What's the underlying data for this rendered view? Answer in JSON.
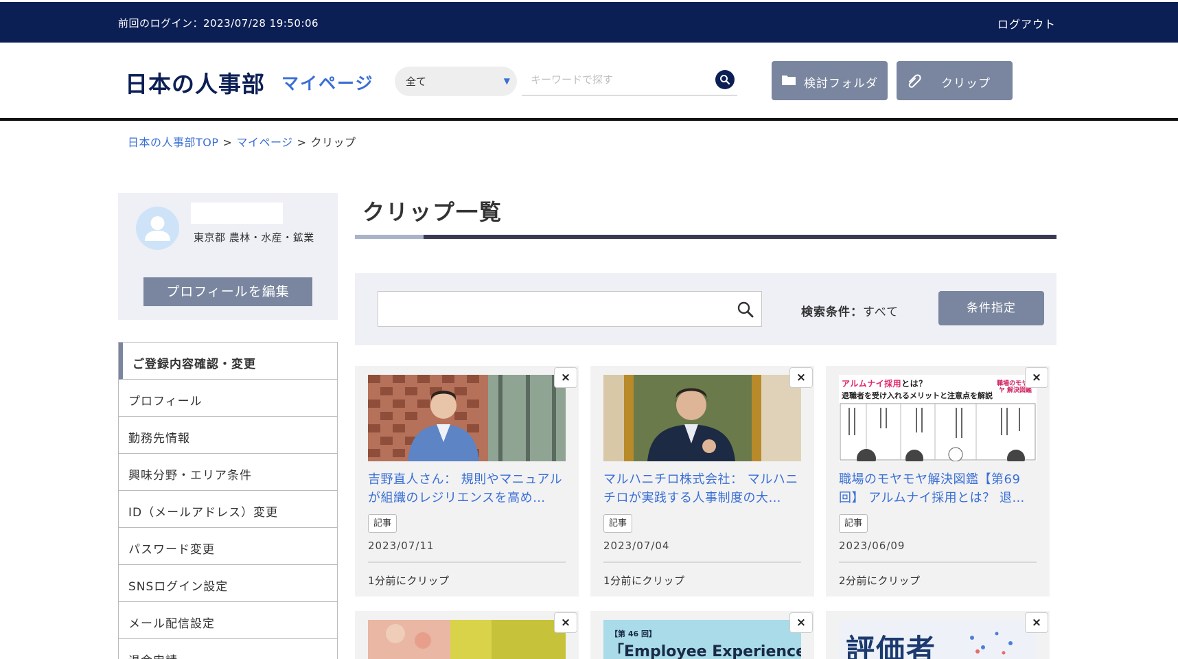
{
  "topbar": {
    "last_login": "前回のログイン：2023/07/28 19:50:06",
    "logout": "ログアウト"
  },
  "header": {
    "logo": "日本の人事部",
    "logo_sub": "マイページ",
    "scope_select": "全て",
    "keyword_placeholder": "キーワードで探す",
    "folder_button": "検討フォルダ",
    "clip_button": "クリップ"
  },
  "breadcrumb": {
    "items": [
      "日本の人事部TOP",
      "マイページ"
    ],
    "separator": ">",
    "current": "クリップ"
  },
  "profile": {
    "location": "東京都 農林・水産・鉱業",
    "edit_button": "プロフィールを編集"
  },
  "side_menu": {
    "header": "ご登録内容確認・変更",
    "items": [
      "プロフィール",
      "勤務先情報",
      "興味分野・エリア条件",
      "ID（メールアドレス）変更",
      "パスワード変更",
      "SNSログイン設定",
      "メール配信設定",
      "退会申請"
    ]
  },
  "main": {
    "title": "クリップ一覧",
    "filter": {
      "placeholder": "",
      "condition_label": "検索条件：",
      "condition_value": "すべて",
      "condition_button": "条件指定"
    },
    "cards": [
      {
        "title": "吉野直人さん： 規則やマニュアルが組織のレジリエンスを高め…",
        "tag": "記事",
        "date": "2023/07/11",
        "clipped": "1分前にクリップ"
      },
      {
        "title": "マルハニチロ株式会社： マルハニチロが実践する人事制度の大…",
        "tag": "記事",
        "date": "2023/07/04",
        "clipped": "1分前にクリップ"
      },
      {
        "title": "職場のモヤモヤ解決図鑑【第69回】 アルムナイ採用とは？ 退…",
        "tag": "記事",
        "date": "2023/06/09",
        "clipped": "2分前にクリップ"
      }
    ],
    "thumb3_caption_red": "アルムナイ採用",
    "thumb3_caption_black": "とは？",
    "thumb3_subcaption": "退職者を受け入れるメリットと注意点を解説",
    "thumb3_badge": "職場のモヤモヤ 解決図鑑",
    "row2_thumb2_badge": "【第 46 回】",
    "row2_thumb2_text": "「Employee Experience",
    "row2_thumb3_text": "評価者",
    "close_label": "×"
  },
  "colors": {
    "navy": "#0c1f55",
    "link_blue": "#3a6fd6",
    "button_gray": "#7a869f",
    "panel_bg": "#eef0f5"
  }
}
